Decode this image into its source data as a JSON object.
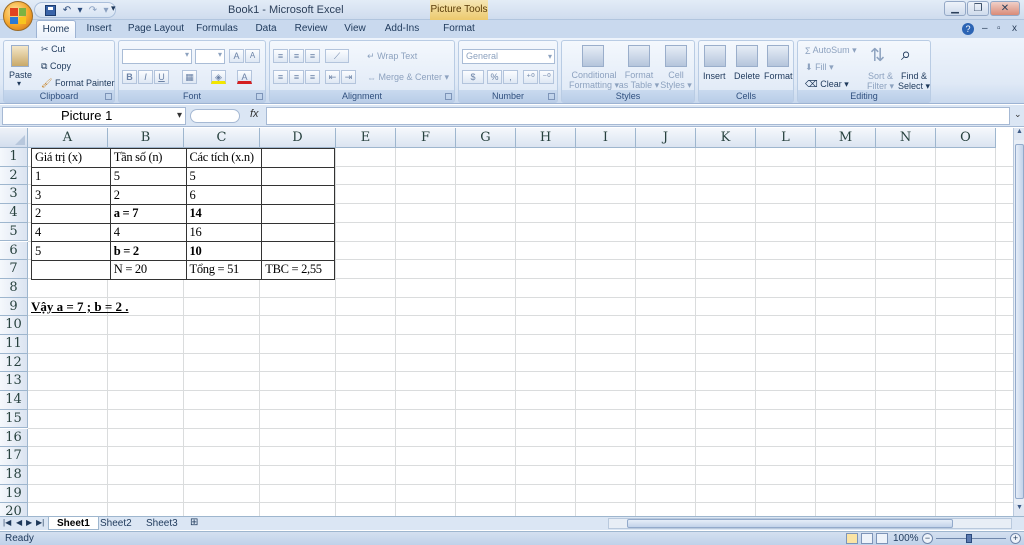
{
  "window": {
    "title": "Book1 - Microsoft Excel",
    "context_tab": "Picture Tools"
  },
  "ribbon": {
    "tabs": [
      "Home",
      "Insert",
      "Page Layout",
      "Formulas",
      "Data",
      "Review",
      "View",
      "Add-Ins",
      "Format"
    ],
    "active_tab": "Home",
    "clipboard": {
      "paste": "Paste",
      "cut": "Cut",
      "copy": "Copy",
      "format_painter": "Format Painter",
      "label": "Clipboard"
    },
    "font": {
      "label": "Font"
    },
    "alignment": {
      "wrap_text": "Wrap Text",
      "merge_center": "Merge & Center",
      "label": "Alignment"
    },
    "number": {
      "format": "General",
      "currency": "$",
      "percent": "%",
      "comma": ",",
      "label": "Number"
    },
    "styles": {
      "conditional_formatting_1": "Conditional",
      "conditional_formatting_2": "Formatting",
      "format_as_table_1": "Format",
      "format_as_table_2": "as Table",
      "cell_styles_1": "Cell",
      "cell_styles_2": "Styles",
      "label": "Styles"
    },
    "cells": {
      "insert": "Insert",
      "delete": "Delete",
      "format": "Format",
      "label": "Cells"
    },
    "editing": {
      "autosum": "AutoSum",
      "fill": "Fill",
      "clear": "Clear",
      "sort_filter_1": "Sort &",
      "sort_filter_2": "Filter",
      "find_select_1": "Find &",
      "find_select_2": "Select",
      "label": "Editing"
    }
  },
  "formula_bar": {
    "name_box": "Picture 1",
    "fx": "fx",
    "formula": ""
  },
  "grid": {
    "columns": [
      "A",
      "B",
      "C",
      "D",
      "E",
      "F",
      "G",
      "H",
      "I",
      "J",
      "K",
      "L",
      "M",
      "N",
      "O"
    ],
    "rows": [
      "1",
      "2",
      "3",
      "4",
      "5",
      "6",
      "7",
      "8",
      "9",
      "10",
      "11",
      "12",
      "13",
      "14",
      "15",
      "16",
      "17",
      "18",
      "19",
      "20"
    ]
  },
  "picture_table": {
    "rows": [
      [
        "Giá trị (x)",
        "Tần số (n)",
        "Các tích (x.n)",
        ""
      ],
      [
        "1",
        "5",
        "5",
        ""
      ],
      [
        "3",
        "2",
        "6",
        ""
      ],
      [
        "2",
        "a = 7",
        "14",
        ""
      ],
      [
        "4",
        "4",
        "16",
        ""
      ],
      [
        "5",
        "b = 2",
        "10",
        ""
      ],
      [
        "",
        "N = 20",
        "Tổng = 51",
        "TBC = 2,55"
      ]
    ]
  },
  "conclusion": "Vậy a = 7 ; b = 2 .",
  "sheets": [
    "Sheet1",
    "Sheet2",
    "Sheet3"
  ],
  "active_sheet": "Sheet1",
  "status": {
    "text": "Ready",
    "zoom": "100%"
  }
}
